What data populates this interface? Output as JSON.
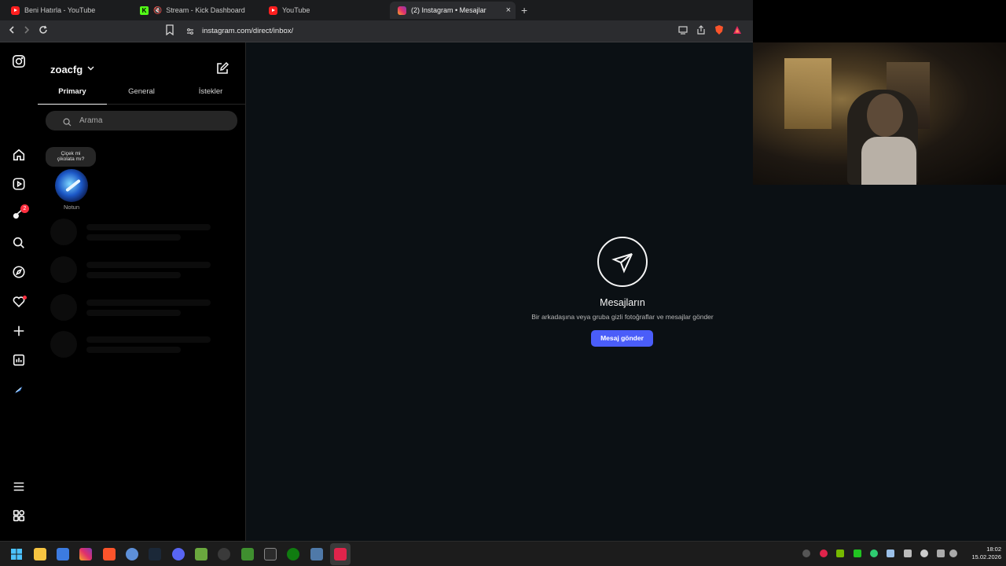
{
  "browser": {
    "tabs": [
      {
        "label": "Beni Hatırla - YouTube",
        "favicon": "youtube-icon"
      },
      {
        "label": "Stream - Kick Dashboard",
        "favicon": "kick-icon",
        "muted": true
      },
      {
        "label": "YouTube",
        "favicon": "youtube-icon"
      },
      {
        "label": "(2) Instagram • Mesajlar",
        "favicon": "instagram-icon",
        "active": true
      }
    ],
    "close_symbol": "×",
    "new_tab_symbol": "+",
    "url": "instagram.com/direct/inbox/"
  },
  "rail": {
    "notification_badge": "2",
    "icons": [
      "instagram-icon",
      "home-icon",
      "reels-icon",
      "messages-icon",
      "search-icon",
      "explore-icon",
      "notifications-icon",
      "create-icon",
      "dashboard-icon",
      "profile-icon",
      "menu-icon",
      "also-from-meta-icon"
    ]
  },
  "inbox": {
    "username": "zoacfg",
    "chevron": "⌄",
    "tabs": [
      "Primary",
      "General",
      "İstekler"
    ],
    "search_placeholder": "Arama",
    "note_text_line1": "Çiçek mi",
    "note_text_line2": "çikolata mı?",
    "note_label": "Notun"
  },
  "empty_state": {
    "title": "Mesajların",
    "subtitle": "Bir arkadaşına veya gruba gizli fotoğraflar ve mesajlar gönder",
    "button": "Mesaj gönder"
  },
  "taskbar": {
    "time": "18:02",
    "date": "15.02.2026"
  },
  "colors": {
    "accent_button": "#4a5df9",
    "notification_red": "#ff3040",
    "page_background": "#0b1014"
  }
}
